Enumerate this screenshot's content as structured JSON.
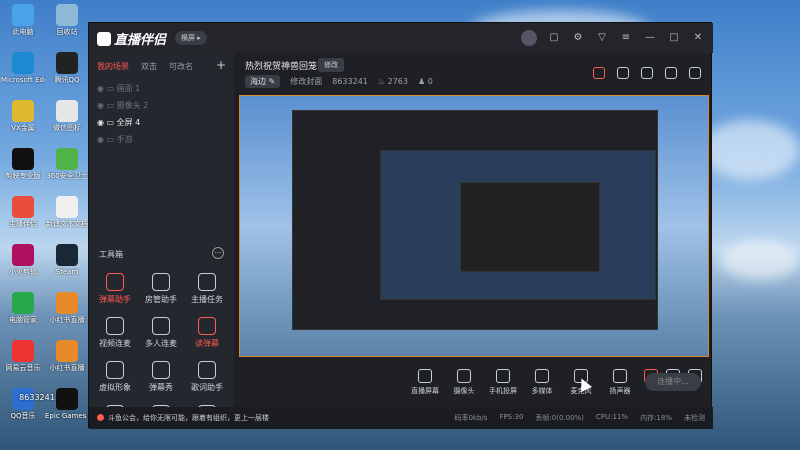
{
  "desktop": {
    "icons": [
      {
        "label": "此电脑",
        "color": "#4aa3e8"
      },
      {
        "label": "回收站",
        "color": "#8fb9d8"
      },
      {
        "label": "Microsoft Edge",
        "color": "#1b8ad0"
      },
      {
        "label": "腾讯QQ",
        "color": "#222"
      },
      {
        "label": "VX金属",
        "color": "#e0b830"
      },
      {
        "label": "微信图标",
        "color": "#e7e7e7"
      },
      {
        "label": "剪映专业版",
        "color": "#111"
      },
      {
        "label": "360安全卫士",
        "color": "#4fb34a"
      },
      {
        "label": "主播伴侣",
        "color": "#e94d3b"
      },
      {
        "label": "新建文本文档",
        "color": "#f0f0f0"
      },
      {
        "label": "小火剪辑",
        "color": "#b0115e"
      },
      {
        "label": "Steam",
        "color": "#1b2838"
      },
      {
        "label": "电脑管家",
        "color": "#27a84a"
      },
      {
        "label": "小红书直播",
        "color": "#e88a2a"
      },
      {
        "label": "网易云音乐",
        "color": "#e33"
      },
      {
        "label": "小红书直播",
        "color": "#e88a2a"
      },
      {
        "label": "QQ音乐",
        "color": "#2c6fd1"
      },
      {
        "label": "Epic Games Launcher",
        "color": "#111"
      }
    ]
  },
  "app": {
    "logo_text": "直播伴侣",
    "mode_label": "横屏",
    "left": {
      "tabs": [
        "我的场景",
        "双击",
        "可改名"
      ],
      "add": "+",
      "scenes": [
        "画面 1",
        "摄像头 2",
        "全屏 4",
        "手游"
      ],
      "tools_title": "工具箱",
      "tools_more": "···",
      "tools": [
        {
          "label": "弹幕助手",
          "red": true
        },
        {
          "label": "房管助手",
          "red": false
        },
        {
          "label": "主播任务",
          "red": false
        },
        {
          "label": "视频连麦",
          "red": false
        },
        {
          "label": "多人连麦",
          "red": false
        },
        {
          "label": "读弹幕",
          "red": true
        },
        {
          "label": "虚拟形象",
          "red": false
        },
        {
          "label": "弹幕秀",
          "red": false
        },
        {
          "label": "歌词助手",
          "red": false
        },
        {
          "label": "",
          "red": false
        },
        {
          "label": "",
          "red": false
        },
        {
          "label": "",
          "red": false
        }
      ]
    },
    "room": {
      "title": "热烈祝贺神兽回笼",
      "edit": "修改",
      "chip": "海边",
      "edit_cover": "修改封面",
      "room_id": "8633241",
      "heat": "2763",
      "viewers": "0"
    },
    "bottom": {
      "buttons": [
        "直播屏幕",
        "摄像头",
        "手机投屏",
        "多媒体",
        "麦克风",
        "扬声器"
      ],
      "start": "连播中..."
    },
    "status": {
      "notice": "斗鱼公会，给你无限可能，跟着有组织，更上一层楼",
      "stats": [
        "码率0kb/s",
        "FPS:30",
        "丢帧:0(0.00%)",
        "CPU:11%",
        "内存:18%",
        "未检测"
      ]
    }
  },
  "corner": {
    "id": "8633241"
  }
}
